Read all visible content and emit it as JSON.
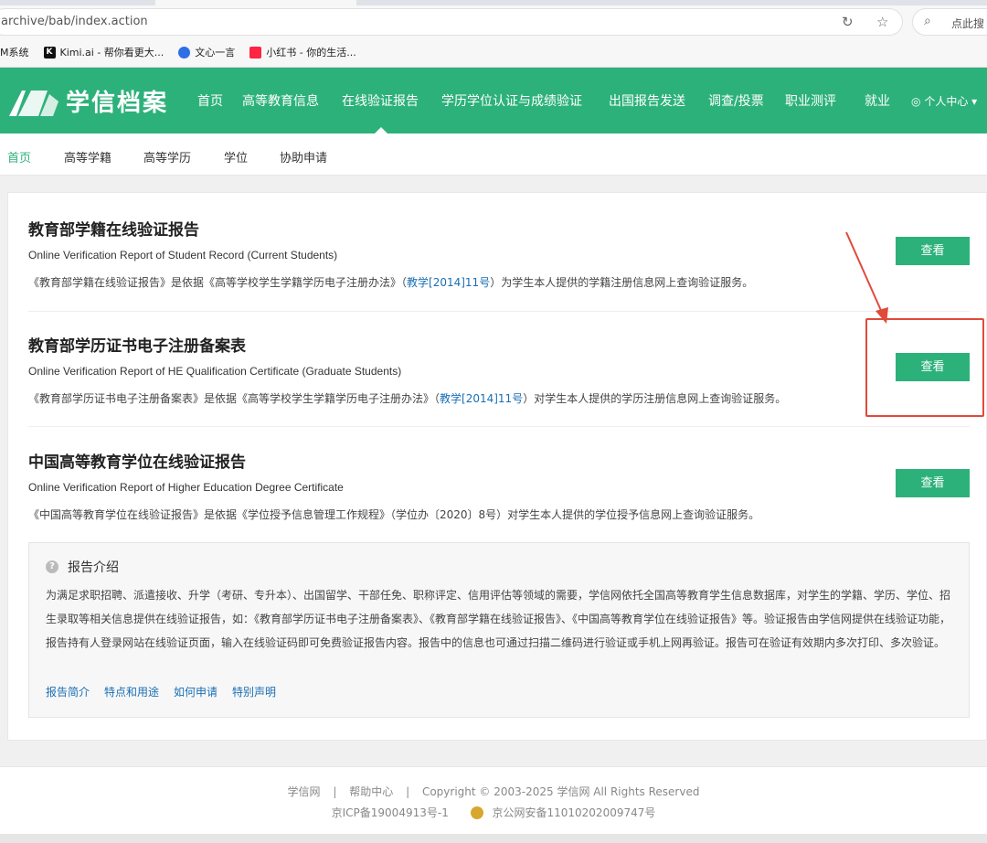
{
  "browser": {
    "url": "archive/bab/index.action",
    "search_placeholder": "点此搜",
    "bookmarks": [
      {
        "label": "M系统",
        "icon": "none"
      },
      {
        "label": "Kimi.ai - 帮你看更大...",
        "icon": "kimi-icon"
      },
      {
        "label": "文心一言",
        "icon": "wenxin-icon"
      },
      {
        "label": "小红书 - 你的生活...",
        "icon": "xiaohongshu-icon"
      }
    ]
  },
  "header": {
    "logo_text": "学信档案",
    "nav": [
      {
        "label": "首页"
      },
      {
        "label": "高等教育信息"
      },
      {
        "label": "在线验证报告"
      },
      {
        "label": "学历学位认证与成绩验证"
      },
      {
        "label": "出国报告发送"
      },
      {
        "label": "调查/投票"
      },
      {
        "label": "职业测评"
      },
      {
        "label": "就业"
      },
      {
        "label": "个人中心"
      }
    ],
    "user_icon": "user-circle-icon",
    "accent_color": "#2db17a"
  },
  "subnav": {
    "items": [
      {
        "label": "首页"
      },
      {
        "label": "高等学籍"
      },
      {
        "label": "高等学历"
      },
      {
        "label": "学位"
      },
      {
        "label": "协助申请"
      }
    ]
  },
  "reports": [
    {
      "title": "教育部学籍在线验证报告",
      "subtitle": "Online Verification Report of Student Record (Current Students)",
      "desc_pre": "《教育部学籍在线验证报告》是依据《高等学校学生学籍学历电子注册办法》（",
      "desc_link": "教学[2014]11号",
      "desc_post": "）为学生本人提供的学籍注册信息网上查询验证服务。",
      "button": "查看"
    },
    {
      "title": "教育部学历证书电子注册备案表",
      "subtitle": "Online Verification Report of HE Qualification Certificate (Graduate Students)",
      "desc_pre": "《教育部学历证书电子注册备案表》是依据《高等学校学生学籍学历电子注册办法》（",
      "desc_link": "教学[2014]11号",
      "desc_post": "）对学生本人提供的学历注册信息网上查询验证服务。",
      "button": "查看"
    },
    {
      "title": "中国高等教育学位在线验证报告",
      "subtitle": "Online Verification Report of Higher Education Degree Certificate",
      "desc_pre": "《中国高等教育学位在线验证报告》是依据《学位授予信息管理工作规程》（学位办〔2020〕8号）对学生本人提供的学位授予信息网上查询验证服务。",
      "desc_link": "",
      "desc_post": "",
      "button": "查看"
    }
  ],
  "intro": {
    "heading": "报告介绍",
    "body": "为满足求职招聘、派遣接收、升学（考研、专升本）、出国留学、干部任免、职称评定、信用评估等领域的需要，学信网依托全国高等教育学生信息数据库，对学生的学籍、学历、学位、招生录取等相关信息提供在线验证报告，如：《教育部学历证书电子注册备案表》、《教育部学籍在线验证报告》、《中国高等教育学位在线验证报告》等。验证报告由学信网提供在线验证功能，报告持有人登录网站在线验证页面，输入在线验证码即可免费验证报告内容。报告中的信息也可通过扫描二维码进行验证或手机上网再验证。报告可在验证有效期内多次打印、多次验证。",
    "links": [
      "报告简介",
      "特点和用途",
      "如何申请",
      "特别声明"
    ]
  },
  "footer": {
    "link1": "学信网",
    "sep": "|",
    "link2": "帮助中心",
    "copyright": "Copyright © 2003-2025 学信网 All Rights Reserved",
    "icp": "京ICP备19004913号-1",
    "police": "京公网安备11010202009747号"
  }
}
